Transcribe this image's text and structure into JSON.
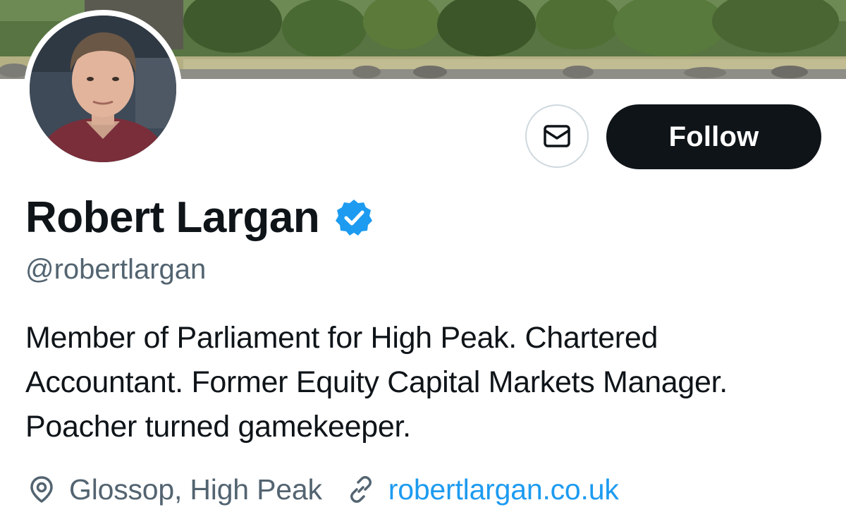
{
  "profile": {
    "display_name": "Robert Largan",
    "handle": "@robertlargan",
    "verified": true,
    "bio_lines": [
      "Member of Parliament for High Peak. Chartered",
      "Accountant. Former Equity Capital Markets Manager.",
      "Poacher turned gamekeeper."
    ],
    "location": "Glossop, High Peak",
    "website": "robertlargan.co.uk"
  },
  "actions": {
    "follow_label": "Follow",
    "message_icon": "envelope-icon"
  },
  "icons": {
    "verified": "verified-badge-icon",
    "location": "location-pin-icon",
    "link": "link-icon"
  },
  "colors": {
    "primary_text": "#0f1419",
    "secondary_text": "#536471",
    "link": "#1d9bf0",
    "verified_badge": "#1d9bf0",
    "follow_button_bg": "#0f1419",
    "follow_button_text": "#ffffff"
  }
}
